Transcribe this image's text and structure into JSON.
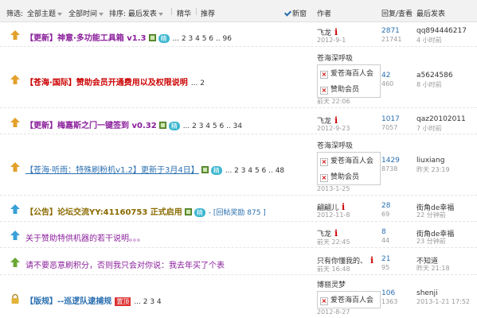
{
  "header": {
    "filter_label": "筛选:",
    "topic": "全部主题",
    "time": "全部时间",
    "sort": "排序: 最后发表",
    "digest": "精华",
    "recommend": "推荐",
    "new_window": "新窗",
    "col_author": "作者",
    "col_reply_view": "回复/查看",
    "col_last": "最后发表"
  },
  "colors": {
    "blue": "#2a6fb0",
    "orange": "#e3a02a",
    "purple": "#8a1e9b",
    "red": "#c00",
    "green": "#6aa833"
  },
  "threads": [
    {
      "icon": "orange-up-arrow-icon",
      "title": "【更新】神意·多功能工具箱 v1.3",
      "title_color": "#8a1e9b",
      "pages": "... 2 3 4 5 6 .. 96",
      "author": "飞龙",
      "date": "2012-9-1",
      "replies": "2871",
      "views": "21741",
      "last_user": "qq894446217",
      "last_time": "4 小时前"
    },
    {
      "icon": "orange-up-arrow-icon",
      "title": "【苍海·国际】赞助会员开通费用以及权限说明",
      "title_color": "#c00",
      "pages": "... 2",
      "popup_head": "苍海深呼吸",
      "popup_items": [
        "爱苍海百人会",
        "赞助会员"
      ],
      "date": "前天 22:06",
      "replies": "42",
      "views": "460",
      "last_user": "a5624586",
      "last_time": "8 小时前"
    },
    {
      "icon": "orange-up-arrow-icon",
      "title": "【更新】梅嘉斯之门一键签到 v0.32",
      "title_color": "#8a1e9b",
      "pages": "... 2 3 4 5 6 .. 34",
      "author": "飞龙",
      "date": "2012-9-23",
      "replies": "1017",
      "views": "7057",
      "last_user": "qaz20102011",
      "last_time": "7 小时前"
    },
    {
      "icon": "orange-up-arrow-icon",
      "title": "【苍海·听雨：特殊刷粉机v1.2】更新于3月4日】",
      "title_color": "#2a6fb0",
      "pages": "... 2 3 4 5 6 .. 48",
      "popup_head": "苍海深呼吸",
      "popup_items": [
        "爱苍海百人会",
        "赞助会员"
      ],
      "date": "2013-1-25",
      "replies": "1429",
      "views": "8738",
      "last_user": "liuxiang",
      "last_time": "昨天 23:19"
    },
    {
      "icon": "blue-up-arrow-icon",
      "title": "【公告】论坛交流YY:41160753 正式启用",
      "title_color": "#8a6a00",
      "pages": "- [回帖奖励 875 ]",
      "author": "翩翩儿",
      "date": "2012-11-8",
      "replies": "28",
      "views": "69",
      "last_user": "街角de幸福",
      "last_time": "22 分钟前"
    },
    {
      "icon": "blue-up-arrow-icon",
      "title": "关于赞助特供机器的若干说明。。。",
      "title_color": "#8a1e9b",
      "pages": "",
      "author": "飞龙",
      "date": "前天 22:45",
      "replies": "8",
      "views": "44",
      "last_user": "街角de幸福",
      "last_time": "23 分钟前"
    },
    {
      "icon": "green-up-arrow-icon",
      "title": "请不要恶意刷积分，否则我只会对你说：我去年买了个表",
      "title_color": "#8a1e9b",
      "pages": "",
      "author": "只有你懂我的、",
      "date": "前天 16:48",
      "replies": "21",
      "views": "95",
      "last_user": "不知道",
      "last_time": "昨天 21:18"
    },
    {
      "icon": "lock-icon",
      "title": "【版规】--巡逻队逮捕规",
      "title_color": "#2a6fb0",
      "pages": "... 2 3 4",
      "popup_head": "博丽灵梦",
      "popup_items": [
        "爱苍海百人会"
      ],
      "date": "2012-8-27",
      "replies": "106",
      "views": "1363",
      "last_user": "shenji",
      "last_time": "2013-1-21 17:52"
    }
  ]
}
